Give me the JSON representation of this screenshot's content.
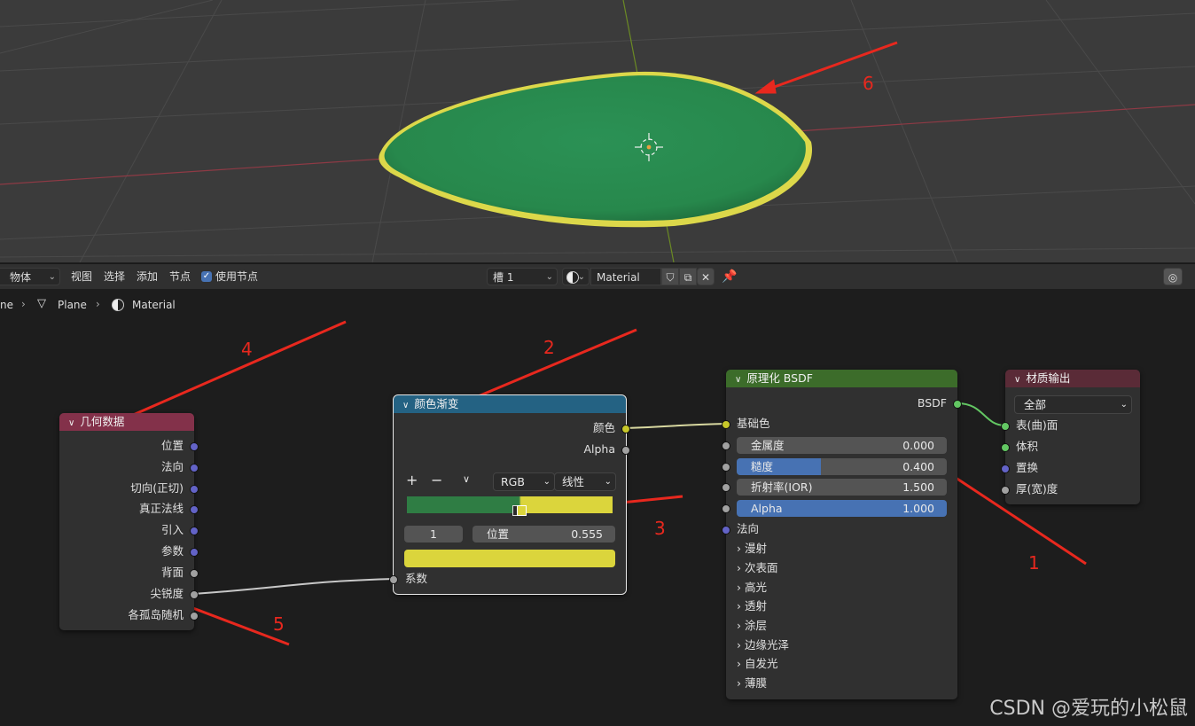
{
  "header": {
    "mode_label": "物体",
    "menus": [
      "视图",
      "选择",
      "添加",
      "节点"
    ],
    "use_nodes_label": "使用节点",
    "slot_label": "槽 1",
    "material_name": "Material"
  },
  "breadcrumb": {
    "item0": "ne",
    "item1": "Plane",
    "item2": "Material"
  },
  "nodes": {
    "geometry": {
      "title": "几何数据",
      "outputs": [
        "位置",
        "法向",
        "切向(正切)",
        "真正法线",
        "引入",
        "参数",
        "背面",
        "尖锐度",
        "各孤岛随机"
      ]
    },
    "color_ramp": {
      "title": "颜色渐变",
      "out_color": "颜色",
      "out_alpha": "Alpha",
      "add": "+",
      "remove": "−",
      "color_mode": "RGB",
      "interpolation": "线性",
      "stop_index": "1",
      "pos_label": "位置",
      "pos_value": "0.555",
      "input_fac": "系数",
      "stop_colors": [
        "#2f7d44",
        "#dbd53c"
      ]
    },
    "bsdf": {
      "title": "原理化 BSDF",
      "out_bsdf": "BSDF",
      "base_color": "基础色",
      "metallic_label": "金属度",
      "metallic_value": "0.000",
      "roughness_label": "糙度",
      "roughness_value": "0.400",
      "roughness": 0.4,
      "ior_label": "折射率(IOR)",
      "ior_value": "1.500",
      "alpha_label": "Alpha",
      "alpha_value": "1.000",
      "normal_label": "法向",
      "panels": [
        "漫射",
        "次表面",
        "高光",
        "透射",
        "涂层",
        "边缘光泽",
        "自发光",
        "薄膜"
      ]
    },
    "output": {
      "title": "材质输出",
      "target": "全部",
      "inputs": [
        "表(曲)面",
        "体积",
        "置换",
        "厚(宽)度"
      ]
    }
  },
  "annotations": [
    "1",
    "2",
    "3",
    "4",
    "5",
    "6"
  ],
  "watermark": "CSDN @爱玩的小松鼠",
  "colors": {
    "accent_blue": "#4772b3",
    "geometry_header": "#83314a",
    "ramp_header": "#246283",
    "bsdf_header": "#3c6c2a",
    "output_header": "#5a2b37",
    "annotation_red": "#e8281e",
    "leaf_green": "#2a8a4e",
    "leaf_rim": "#dcd84a"
  }
}
